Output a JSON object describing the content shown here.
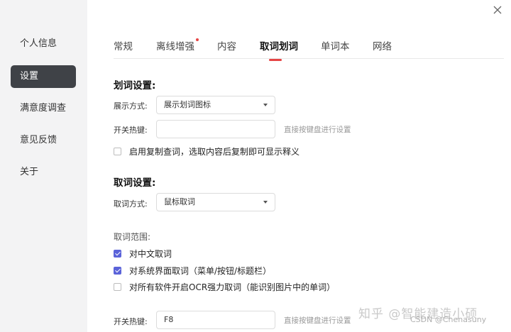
{
  "sidebar": {
    "items": [
      {
        "label": "个人信息"
      },
      {
        "label": "设置"
      },
      {
        "label": "满意度调查"
      },
      {
        "label": "意见反馈"
      },
      {
        "label": "关于"
      }
    ]
  },
  "tabs": [
    {
      "label": "常规"
    },
    {
      "label": "离线增强"
    },
    {
      "label": "内容"
    },
    {
      "label": "取词划词"
    },
    {
      "label": "单词本"
    },
    {
      "label": "网络"
    }
  ],
  "highlight_section": {
    "title": "划词设置:",
    "display_mode_label": "展示方式:",
    "display_mode_value": "展示划词图标",
    "hotkey_label": "开关热键:",
    "hotkey_value": "",
    "hotkey_hint": "直接按键盘进行设置",
    "copy_lookup_label": "启用复制查词，选取内容后复制即可显示释义",
    "copy_lookup_checked": false
  },
  "capture_section": {
    "title": "取词设置:",
    "mode_label": "取词方式:",
    "mode_value": "鼠标取词",
    "range_label": "取词范围:",
    "options": [
      {
        "label": "对中文取词",
        "checked": true
      },
      {
        "label": "对系统界面取词（菜单/按钮/标题栏）",
        "checked": true
      },
      {
        "label": "对所有软件开启OCR强力取词（能识别图片中的单词）",
        "checked": false
      }
    ],
    "hotkey_label": "开关热键:",
    "hotkey_value": "F8",
    "hotkey_hint": "直接按键盘进行设置"
  },
  "watermark": {
    "zhihu": "知乎 @智能建造小硕",
    "csdn": "CSDN @Chenasuny"
  },
  "colors": {
    "sidebar_bg": "#f3f3f4",
    "sidebar_active": "#3f4247",
    "accent_red": "#e64545",
    "checkbox_checked": "#5b63d9"
  }
}
